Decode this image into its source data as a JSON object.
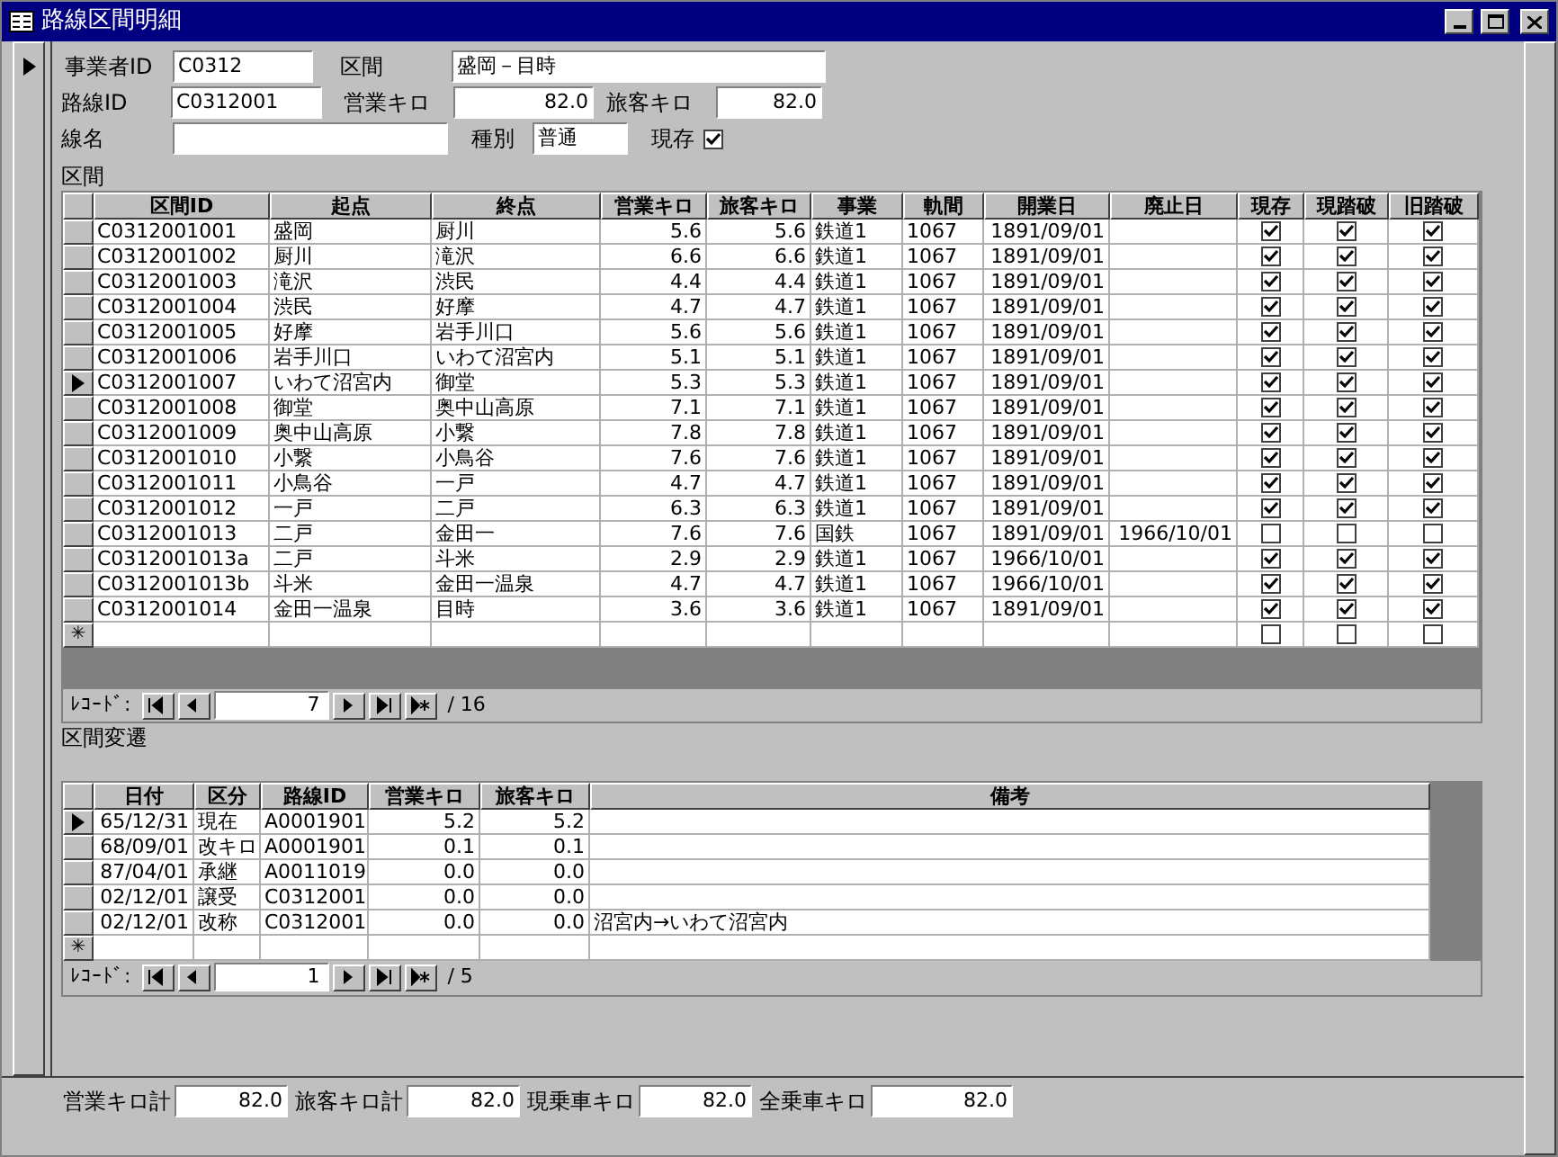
{
  "window": {
    "title": "路線区間明細"
  },
  "header": {
    "operator_id": {
      "label": "事業者ID",
      "value": "C0312"
    },
    "section": {
      "label": "区間",
      "value": "盛岡－目時"
    },
    "route_id": {
      "label": "路線ID",
      "value": "C0312001"
    },
    "business_km": {
      "label": "営業キロ",
      "value": "82.0"
    },
    "passenger_km": {
      "label": "旅客キロ",
      "value": "82.0"
    },
    "line_name": {
      "label": "線名"
    },
    "type": {
      "label": "種別",
      "value": "普通"
    },
    "existing": {
      "label": "現存",
      "checked": true
    }
  },
  "segments": {
    "label": "区間",
    "columns": [
      "区間ID",
      "起点",
      "終点",
      "営業キロ",
      "旅客キロ",
      "事業",
      "軌間",
      "開業日",
      "廃止日",
      "現存",
      "現踏破",
      "旧踏破"
    ],
    "rows": [
      {
        "selected": false,
        "values": [
          "C0312001001",
          "盛岡",
          "厨川",
          "5.6",
          "5.6",
          "鉄道1",
          "1067",
          "1891/09/01"
        ],
        "checks": [
          true,
          true,
          true
        ]
      },
      {
        "selected": false,
        "values": [
          "C0312001002",
          "厨川",
          "滝沢",
          "6.6",
          "6.6",
          "鉄道1",
          "1067",
          "1891/09/01"
        ],
        "checks": [
          true,
          true,
          true
        ]
      },
      {
        "selected": false,
        "values": [
          "C0312001003",
          "滝沢",
          "渋民",
          "4.4",
          "4.4",
          "鉄道1",
          "1067",
          "1891/09/01"
        ],
        "checks": [
          true,
          true,
          true
        ]
      },
      {
        "selected": false,
        "values": [
          "C0312001004",
          "渋民",
          "好摩",
          "4.7",
          "4.7",
          "鉄道1",
          "1067",
          "1891/09/01"
        ],
        "checks": [
          true,
          true,
          true
        ]
      },
      {
        "selected": false,
        "values": [
          "C0312001005",
          "好摩",
          "岩手川口",
          "5.6",
          "5.6",
          "鉄道1",
          "1067",
          "1891/09/01"
        ],
        "checks": [
          true,
          true,
          true
        ]
      },
      {
        "selected": false,
        "values": [
          "C0312001006",
          "岩手川口",
          "いわて沼宮内",
          "5.1",
          "5.1",
          "鉄道1",
          "1067",
          "1891/09/01"
        ],
        "checks": [
          true,
          true,
          true
        ]
      },
      {
        "selected": true,
        "values": [
          "C0312001007",
          "いわて沼宮内",
          "御堂",
          "5.3",
          "5.3",
          "鉄道1",
          "1067",
          "1891/09/01"
        ],
        "checks": [
          true,
          true,
          true
        ]
      },
      {
        "selected": false,
        "values": [
          "C0312001008",
          "御堂",
          "奥中山高原",
          "7.1",
          "7.1",
          "鉄道1",
          "1067",
          "1891/09/01"
        ],
        "checks": [
          true,
          true,
          true
        ]
      },
      {
        "selected": false,
        "values": [
          "C0312001009",
          "奥中山高原",
          "小繋",
          "7.8",
          "7.8",
          "鉄道1",
          "1067",
          "1891/09/01"
        ],
        "checks": [
          true,
          true,
          true
        ]
      },
      {
        "selected": false,
        "values": [
          "C0312001010",
          "小繋",
          "小鳥谷",
          "7.6",
          "7.6",
          "鉄道1",
          "1067",
          "1891/09/01"
        ],
        "checks": [
          true,
          true,
          true
        ]
      },
      {
        "selected": false,
        "values": [
          "C0312001011",
          "小鳥谷",
          "一戸",
          "4.7",
          "4.7",
          "鉄道1",
          "1067",
          "1891/09/01"
        ],
        "checks": [
          true,
          true,
          true
        ]
      },
      {
        "selected": false,
        "values": [
          "C0312001012",
          "一戸",
          "二戸",
          "6.3",
          "6.3",
          "鉄道1",
          "1067",
          "1891/09/01"
        ],
        "checks": [
          true,
          true,
          true
        ]
      },
      {
        "selected": false,
        "values": [
          "C0312001013",
          "二戸",
          "金田一",
          "7.6",
          "7.6",
          "国鉄",
          "1067",
          "1891/09/01",
          "1966/10/01"
        ],
        "checks": [
          false,
          false,
          false
        ]
      },
      {
        "selected": false,
        "values": [
          "C0312001013a",
          "二戸",
          "斗米",
          "2.9",
          "2.9",
          "鉄道1",
          "1067",
          "1966/10/01"
        ],
        "checks": [
          true,
          true,
          true
        ]
      },
      {
        "selected": false,
        "values": [
          "C0312001013b",
          "斗米",
          "金田一温泉",
          "4.7",
          "4.7",
          "鉄道1",
          "1067",
          "1966/10/01"
        ],
        "checks": [
          true,
          true,
          true
        ]
      },
      {
        "selected": false,
        "values": [
          "C0312001014",
          "金田一温泉",
          "目時",
          "3.6",
          "3.6",
          "鉄道1",
          "1067",
          "1891/09/01"
        ],
        "checks": [
          true,
          true,
          true
        ]
      }
    ],
    "new_row": {
      "marker": "✳",
      "checks": [
        false,
        false,
        false
      ]
    },
    "navigator": {
      "label": "ﾚｺｰﾄﾞ:",
      "value": "7",
      "total": "/ 16"
    }
  },
  "history": {
    "label": "区間変遷",
    "columns": [
      "日付",
      "区分",
      "路線ID",
      "営業キロ",
      "旅客キロ",
      "備考"
    ],
    "rows": [
      {
        "selected": true,
        "values": [
          "65/12/31",
          "現在",
          "A0001901",
          "5.2",
          "5.2"
        ]
      },
      {
        "selected": false,
        "values": [
          "68/09/01",
          "改キロ",
          "A0001901",
          "0.1",
          "0.1"
        ]
      },
      {
        "selected": false,
        "values": [
          "87/04/01",
          "承継",
          "A0011019",
          "0.0",
          "0.0"
        ]
      },
      {
        "selected": false,
        "values": [
          "02/12/01",
          "譲受",
          "C0312001",
          "0.0",
          "0.0"
        ]
      },
      {
        "selected": false,
        "values": [
          "02/12/01",
          "改称",
          "C0312001",
          "0.0",
          "0.0",
          "沼宮内→いわて沼宮内"
        ]
      }
    ],
    "new_row": {
      "marker": "✳"
    },
    "navigator": {
      "label": "ﾚｺｰﾄﾞ:",
      "value": "1",
      "total": "/ 5"
    }
  },
  "footer": [
    {
      "label": "営業キロ計",
      "value": "82.0"
    },
    {
      "label": "旅客キロ計",
      "value": "82.0"
    },
    {
      "label": "現乗車キロ",
      "value": "82.0"
    },
    {
      "label": "全乗車キロ",
      "value": "82.0"
    }
  ]
}
